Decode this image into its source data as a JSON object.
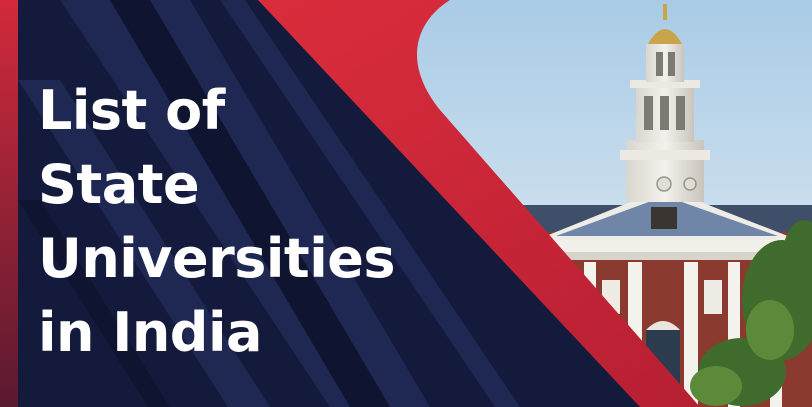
{
  "banner": {
    "title_lines": [
      "List of",
      "State",
      "Universities",
      "in India"
    ],
    "colors": {
      "navy": "#13193a",
      "navy_stripe": "#1d2750",
      "red": "#d0283a",
      "sky": "#bcd6ea",
      "text": "#ffffff"
    },
    "image": {
      "description_icon": "university-building-photo"
    }
  }
}
